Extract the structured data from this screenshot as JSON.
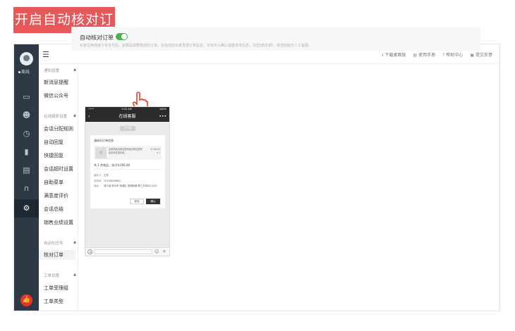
{
  "banner": {
    "title": "开启自动核对订单"
  },
  "rail": {
    "status": "离线"
  },
  "topbar": {
    "links": [
      {
        "icon": "download-icon",
        "glyph": "⭳",
        "label": "下载桌面版"
      },
      {
        "icon": "manual-icon",
        "glyph": "▤",
        "label": "使用手册"
      },
      {
        "icon": "help-icon",
        "glyph": "?",
        "label": "帮助中心"
      },
      {
        "icon": "feedback-icon",
        "glyph": "▣",
        "label": "提交反馈"
      }
    ]
  },
  "sidebar": {
    "sections": [
      {
        "title": "通知设置",
        "items": [
          "新消息提醒",
          "微信公众号"
        ]
      },
      {
        "title": "在线服务设置",
        "items": [
          "会话分配规则",
          "自动回复",
          "快捷回复",
          "会话超时设置",
          "自助菜单",
          "满意度评价",
          "会话总结",
          "销售业绩设置"
        ]
      },
      {
        "title": "自动化任务",
        "items": [
          "核对订单"
        ]
      },
      {
        "title": "工单设置",
        "items": [
          "工单受理组",
          "工单类型"
        ]
      }
    ]
  },
  "setting": {
    "title": "自动核对订单",
    "enabled": true,
    "description": "买家在微商城下单支付后，如果是需要物流的订单，会自动给买家发送订单信息，买家可以确认或者修改信息。点击[修改]时，将自动转交人工客服。"
  },
  "phone": {
    "status_left": "•••• ",
    "time": "9:41 AM",
    "battery": "100%",
    "header": "在线客服",
    "tag": "已下单",
    "card_title": "请核对订单信息",
    "thumb": "图",
    "product_name": "这是商品名称这是商品名称这是商品名称这是商品...",
    "product_price": "￥100.00",
    "product_qty": "x 1",
    "total": "共 1 件商品，实付￥295.00",
    "receiver_label": "收件人：",
    "receiver": "王芳",
    "phone_label": "手机号：",
    "phone": "15158035685",
    "address_label": "地址：",
    "address": "浙江省 杭州市 西湖区 西湖街道 教工万科中心G25",
    "btn_modify": "修改",
    "btn_confirm": "确认"
  }
}
